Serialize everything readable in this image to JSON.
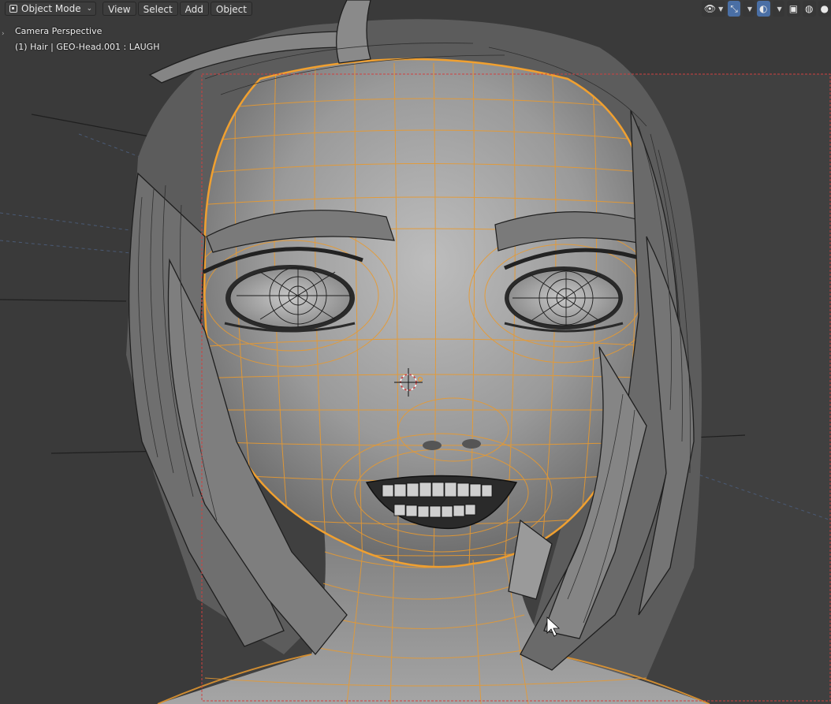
{
  "header": {
    "mode_label": "Object Mode",
    "menu": [
      "View",
      "Select",
      "Add",
      "Object"
    ]
  },
  "right_tools": [
    {
      "icon": "eye-visibility-icon"
    },
    {
      "icon": "gizmo-icon",
      "active": true
    },
    {
      "icon": "overlay-icon",
      "active": true
    },
    {
      "icon": "xray-icon"
    },
    {
      "icon": "wireframe-shading-icon"
    },
    {
      "icon": "solid-shading-icon"
    }
  ],
  "viewport": {
    "view_name": "Camera Perspective",
    "object_info": "(1) Hair | GEO-Head.001 : LAUGH"
  },
  "colors": {
    "background": "#3a3a3a",
    "selection_orange": "#e89a30",
    "camera_border": "#d04040",
    "mesh_gray": "#8c8c8c"
  }
}
